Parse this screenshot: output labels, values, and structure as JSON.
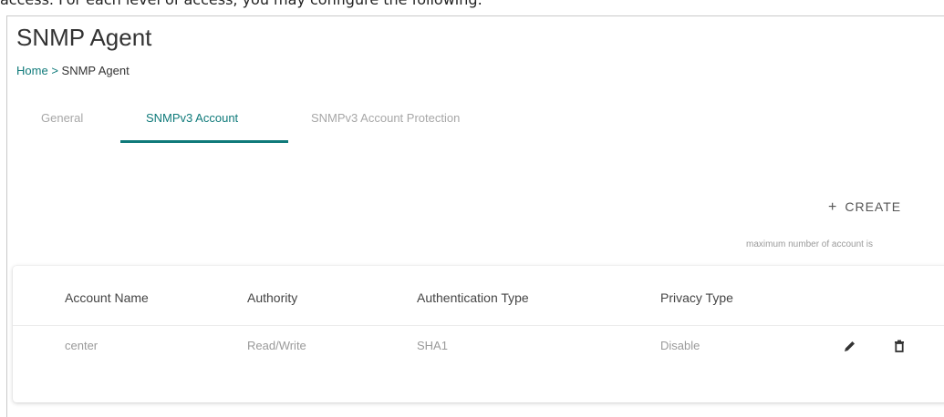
{
  "doc_text": "access. For each level of access, you may configure the following:",
  "page": {
    "title": "SNMP Agent",
    "breadcrumb": {
      "home": "Home",
      "separator": ">",
      "current": "SNMP Agent"
    }
  },
  "tabs": [
    {
      "label": "General",
      "active": false
    },
    {
      "label": "SNMPv3 Account",
      "active": true
    },
    {
      "label": "SNMPv3 Account Protection",
      "active": false
    }
  ],
  "toolbar": {
    "create_label": "CREATE",
    "create_icon": "plus-icon",
    "max_note": "maximum number of account is"
  },
  "table": {
    "headers": [
      "Account Name",
      "Authority",
      "Authentication Type",
      "Privacy Type"
    ],
    "rows": [
      {
        "account_name": "center",
        "authority": "Read/Write",
        "authentication_type": "SHA1",
        "privacy_type": "Disable",
        "actions": [
          "edit-icon",
          "delete-icon"
        ]
      }
    ]
  },
  "colors": {
    "accent": "#0f7a7a",
    "muted_text": "#9a9a9a",
    "tab_inactive": "#a7a7a7"
  }
}
